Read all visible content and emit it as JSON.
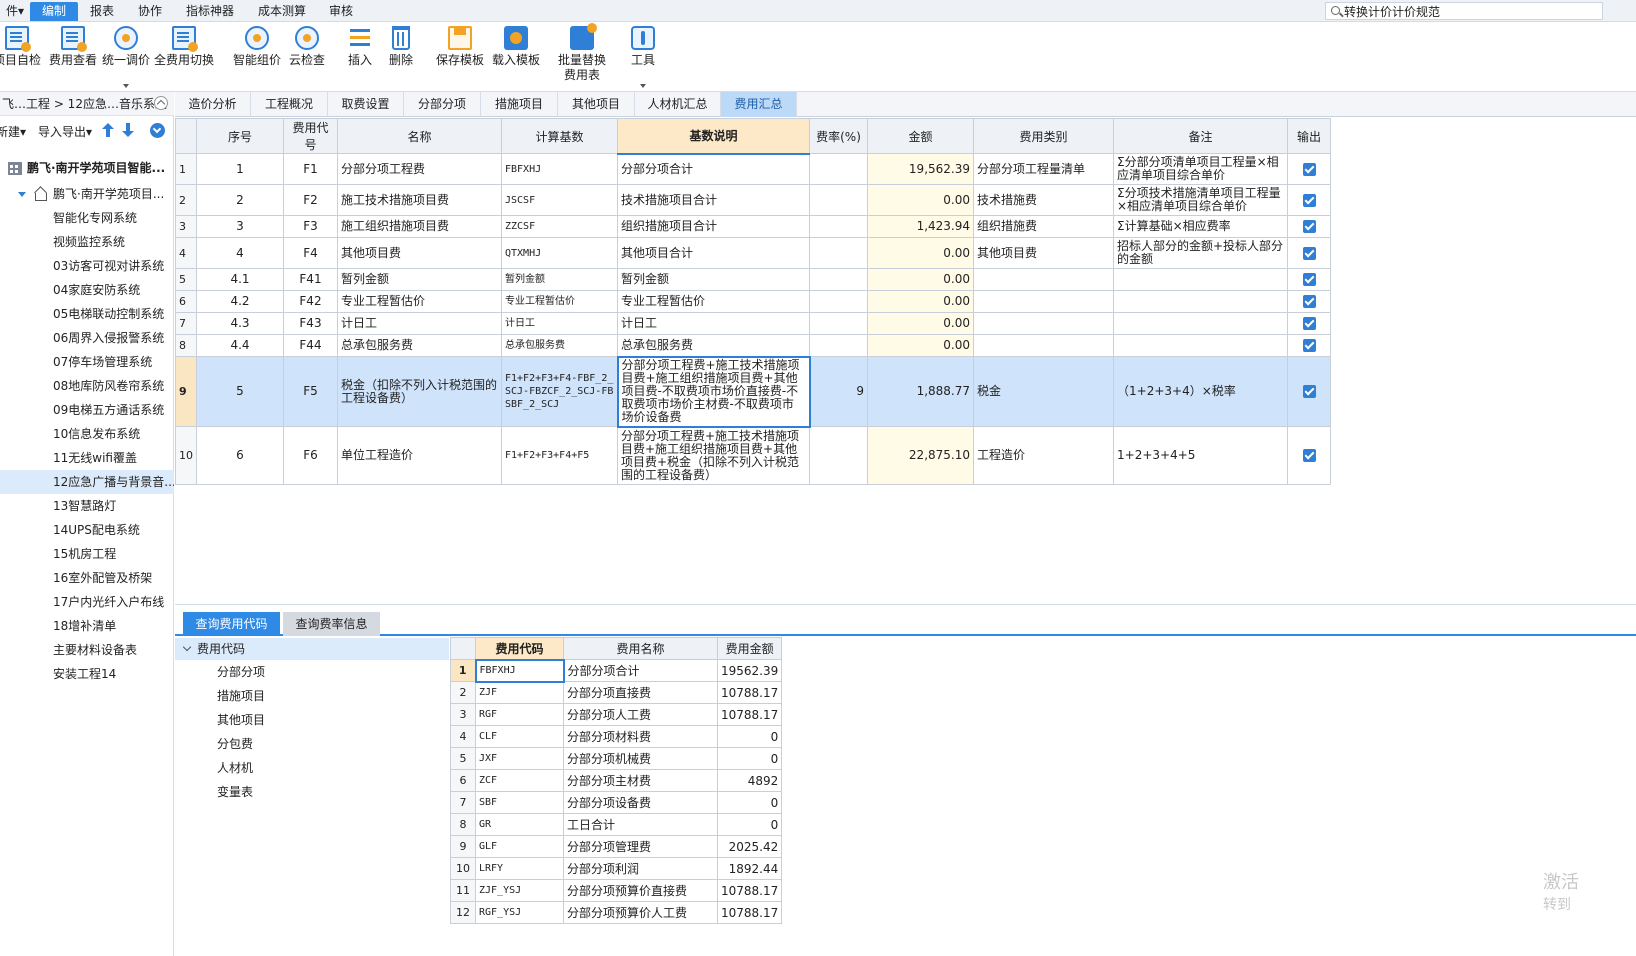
{
  "menu": [
    "件▾",
    "编制",
    "报表",
    "协作",
    "指标神器",
    "成本测算",
    "审核"
  ],
  "menu_active_index": 1,
  "search": {
    "value": "转换计价计价规范"
  },
  "toolbar": [
    {
      "label": "项目自检",
      "icon": "doc-check-icon"
    },
    {
      "label": "费用查看",
      "icon": "fee-view-icon"
    },
    {
      "label": "统一调价",
      "icon": "price-adjust-icon",
      "dropdown": true
    },
    {
      "label": "全费用切换",
      "icon": "full-fee-switch-icon"
    },
    {
      "label": "智能组价",
      "icon": "smart-price-icon"
    },
    {
      "label": "云检查",
      "icon": "cloud-check-icon"
    },
    {
      "label": "插入",
      "icon": "insert-icon"
    },
    {
      "label": "删除",
      "icon": "delete-icon"
    },
    {
      "label": "保存模板",
      "icon": "save-template-icon"
    },
    {
      "label": "载入模板",
      "icon": "load-template-icon"
    },
    {
      "label": "批量替换",
      "label2": "费用表",
      "icon": "batch-replace-icon"
    },
    {
      "label": "工具",
      "icon": "tools-icon",
      "dropdown": true
    }
  ],
  "left": {
    "breadcrumb": "飞…工程 > 12应急…音乐系统",
    "new_label": "新建▾",
    "import_label": "导入导出▾",
    "tree_root": "鹏飞·南开学苑项目智能...",
    "tree_sub": "鹏飞·南开学苑项目...",
    "items": [
      "智能化专网系统",
      "视频监控系统",
      "03访客可视对讲系统",
      "04家庭安防系统",
      "05电梯联动控制系统",
      "06周界入侵报警系统",
      "07停车场管理系统",
      "08地库防风卷帘系统",
      "09电梯五方通话系统",
      "10信息发布系统",
      "11无线wifi覆盖",
      "12应急广播与背景音...",
      "13智慧路灯",
      "14UPS配电系统",
      "15机房工程",
      "16室外配管及桥架",
      "17户内光纤入户布线",
      "18增补清单",
      "主要材料设备表",
      "安装工程14"
    ],
    "selected_index": 11
  },
  "tabs": [
    "造价分析",
    "工程概况",
    "取费设置",
    "分部分项",
    "措施项目",
    "其他项目",
    "人材机汇总",
    "费用汇总"
  ],
  "active_tab": 7,
  "grid": {
    "headers": [
      "",
      "序号",
      "费用代号",
      "名称",
      "计算基数",
      "基数说明",
      "费率(%)",
      "金额",
      "费用类别",
      "备注",
      "输出"
    ],
    "rows": [
      {
        "n": "1",
        "seq": "1",
        "code": "F1",
        "name": "分部分项工程费",
        "base": "FBFXHJ",
        "desc": "分部分项合计",
        "rate": "",
        "amount": "19,562.39",
        "cat": "分部分项工程量清单",
        "note": "Σ分部分项清单项目工程量×相应清单项目综合单价"
      },
      {
        "n": "2",
        "seq": "2",
        "code": "F2",
        "name": "施工技术措施项目费",
        "base": "JSCSF",
        "desc": "技术措施项目合计",
        "rate": "",
        "amount": "0.00",
        "cat": "技术措施费",
        "note": "Σ分项技术措施清单项目工程量×相应清单项目综合单价"
      },
      {
        "n": "3",
        "seq": "3",
        "code": "F3",
        "name": "施工组织措施项目费",
        "base": "ZZCSF",
        "desc": "组织措施项目合计",
        "rate": "",
        "amount": "1,423.94",
        "cat": "组织措施费",
        "note": "Σ计算基础×相应费率"
      },
      {
        "n": "4",
        "seq": "4",
        "code": "F4",
        "name": "其他项目费",
        "base": "QTXMHJ",
        "desc": "其他项目合计",
        "rate": "",
        "amount": "0.00",
        "cat": "其他项目费",
        "note": "招标人部分的金额+投标人部分的金额"
      },
      {
        "n": "5",
        "seq": "4.1",
        "code": "F41",
        "name": "暂列金额",
        "base": "暂列金额",
        "desc": "暂列金额",
        "rate": "",
        "amount": "0.00",
        "cat": "",
        "note": ""
      },
      {
        "n": "6",
        "seq": "4.2",
        "code": "F42",
        "name": "专业工程暂估价",
        "base": "专业工程暂估价",
        "desc": "专业工程暂估价",
        "rate": "",
        "amount": "0.00",
        "cat": "",
        "note": ""
      },
      {
        "n": "7",
        "seq": "4.3",
        "code": "F43",
        "name": "计日工",
        "base": "计日工",
        "desc": "计日工",
        "rate": "",
        "amount": "0.00",
        "cat": "",
        "note": ""
      },
      {
        "n": "8",
        "seq": "4.4",
        "code": "F44",
        "name": "总承包服务费",
        "base": "总承包服务费",
        "desc": "总承包服务费",
        "rate": "",
        "amount": "0.00",
        "cat": "",
        "note": ""
      },
      {
        "n": "9",
        "seq": "5",
        "code": "F5",
        "name": "税金（扣除不列入计税范围的工程设备费）",
        "base": "F1+F2+F3+F4-FBF_2_SCJ-FBZCF_2_SCJ-FBSBF_2_SCJ",
        "desc": "分部分项工程费+施工技术措施项目费+施工组织措施项目费+其他项目费-不取费项市场价直接费-不取费项市场价主材费-不取费项市场价设备费",
        "rate": "9",
        "amount": "1,888.77",
        "cat": "税金",
        "note": "（1+2+3+4）×税率"
      },
      {
        "n": "10",
        "seq": "6",
        "code": "F6",
        "name": "单位工程造价",
        "base": "F1+F2+F3+F4+F5",
        "desc": "分部分项工程费+施工技术措施项目费+施工组织措施项目费+其他项目费+税金（扣除不列入计税范围的工程设备费）",
        "rate": "",
        "amount": "22,875.10",
        "cat": "工程造价",
        "note": "1+2+3+4+5"
      }
    ],
    "selected_row": 8
  },
  "bottom": {
    "tabs": [
      "查询费用代码",
      "查询费率信息"
    ],
    "tree_head": "费用代码",
    "tree_items": [
      "分部分项",
      "措施项目",
      "其他项目",
      "分包费",
      "人材机",
      "变量表"
    ],
    "headers": [
      "",
      "费用代码",
      "费用名称",
      "费用金额"
    ],
    "rows": [
      {
        "n": "1",
        "code": "FBFXHJ",
        "name": "分部分项合计",
        "amount": "19562.39"
      },
      {
        "n": "2",
        "code": "ZJF",
        "name": "分部分项直接费",
        "amount": "10788.17"
      },
      {
        "n": "3",
        "code": "RGF",
        "name": "分部分项人工费",
        "amount": "10788.17"
      },
      {
        "n": "4",
        "code": "CLF",
        "name": "分部分项材料费",
        "amount": "0"
      },
      {
        "n": "5",
        "code": "JXF",
        "name": "分部分项机械费",
        "amount": "0"
      },
      {
        "n": "6",
        "code": "ZCF",
        "name": "分部分项主材费",
        "amount": "4892"
      },
      {
        "n": "7",
        "code": "SBF",
        "name": "分部分项设备费",
        "amount": "0"
      },
      {
        "n": "8",
        "code": "GR",
        "name": "工日合计",
        "amount": "0"
      },
      {
        "n": "9",
        "code": "GLF",
        "name": "分部分项管理费",
        "amount": "2025.42"
      },
      {
        "n": "10",
        "code": "LRFY",
        "name": "分部分项利润",
        "amount": "1892.44"
      },
      {
        "n": "11",
        "code": "ZJF_YSJ",
        "name": "分部分项预算价直接费",
        "amount": "10788.17"
      },
      {
        "n": "12",
        "code": "RGF_YSJ",
        "name": "分部分项预算价人工费",
        "amount": "10788.17"
      }
    ]
  },
  "watermark": [
    "激活",
    "转到"
  ]
}
